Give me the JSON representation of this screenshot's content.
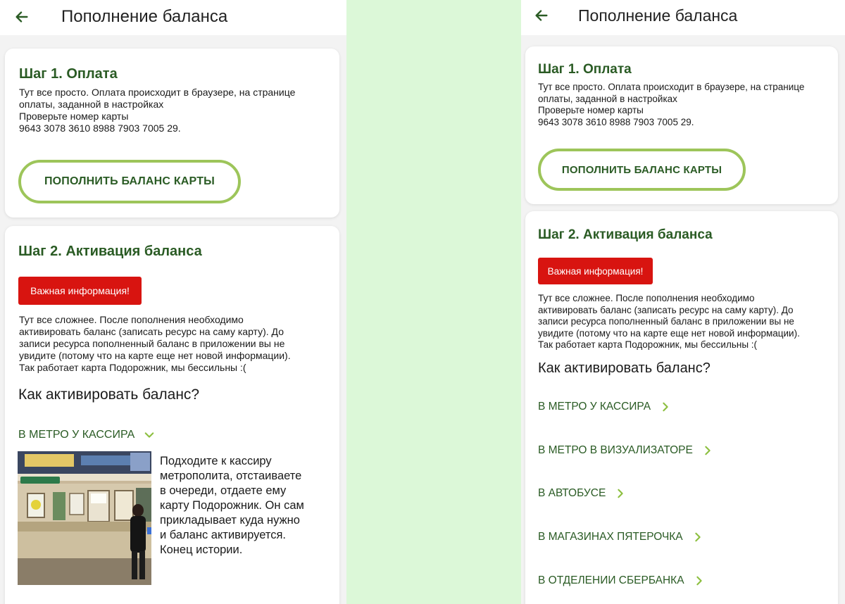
{
  "colors": {
    "accent_green": "#2a5b24",
    "pill_border": "#9dc55a",
    "important_red": "#d81410",
    "divider_bg": "#dcf8d8"
  },
  "left": {
    "header": {
      "title": "Пополнение баланса",
      "back_icon": "arrow-left-icon"
    },
    "step1": {
      "title": "Шаг 1. Оплата",
      "text_lines": [
        "Тут все просто. Оплата происходит в браузере, на странице",
        "оплаты, заданной в настройках",
        "Проверьте номер карты",
        "9643 3078 3610 8988 7903 7005 29."
      ],
      "button_label": "ПОПОЛНИТЬ БАЛАНС КАРТЫ"
    },
    "step2": {
      "title": "Шаг 2. Активация баланса",
      "important_label": "Важная информация!",
      "text_lines": [
        "Тут все сложнее. После пополнения необходимо",
        "активировать баланс (записать ресурс на саму карту). До",
        "записи ресурса пополненный баланс в приложении вы не",
        "увидите (потому что на карте еще нет новой информации).",
        "Так работает карта Подорожник, мы бессильны :("
      ],
      "how_title": "Как активировать баланс?",
      "expanded_option": {
        "label": "В МЕТРО У КАССИРА",
        "icon": "chevron-down-icon",
        "description_lines": [
          "Подходите к кассиру",
          "метрополита, отстаиваете",
          "в очереди, отдаете ему",
          "карту Подорожник. Он сам",
          "прикладывает куда нужно",
          "и баланс активируется.",
          "Конец истории."
        ]
      }
    }
  },
  "right": {
    "header": {
      "title": "Пополнение баланса",
      "back_icon": "arrow-left-icon"
    },
    "step1": {
      "title": "Шаг 1. Оплата",
      "text_lines": [
        "Тут все просто. Оплата происходит в браузере, на странице",
        "оплаты, заданной в настройках",
        "Проверьте номер карты",
        "9643 3078 3610 8988 7903 7005 29."
      ],
      "button_label": "ПОПОЛНИТЬ БАЛАНС КАРТЫ"
    },
    "step2": {
      "title": "Шаг 2. Активация баланса",
      "important_label": "Важная информация!",
      "text_lines": [
        "Тут все сложнее. После пополнения необходимо",
        "активировать баланс (записать ресурс на саму карту). До",
        "записи ресурса пополненный баланс в приложении вы не",
        "увидите (потому что на карте еще нет новой информации).",
        "Так работает карта Подорожник, мы бессильны :("
      ],
      "how_title": "Как активировать баланс?",
      "options": [
        {
          "label": "В МЕТРО У КАССИРА",
          "icon": "chevron-right-icon"
        },
        {
          "label": "В МЕТРО В ВИЗУАЛИЗАТОРЕ",
          "icon": "chevron-right-icon"
        },
        {
          "label": "В АВТОБУСЕ",
          "icon": "chevron-right-icon"
        },
        {
          "label": "В МАГАЗИНАХ ПЯТЕРОЧКА",
          "icon": "chevron-right-icon"
        },
        {
          "label": "В ОТДЕЛЕНИИ СБЕРБАНКА",
          "icon": "chevron-right-icon"
        }
      ]
    }
  }
}
